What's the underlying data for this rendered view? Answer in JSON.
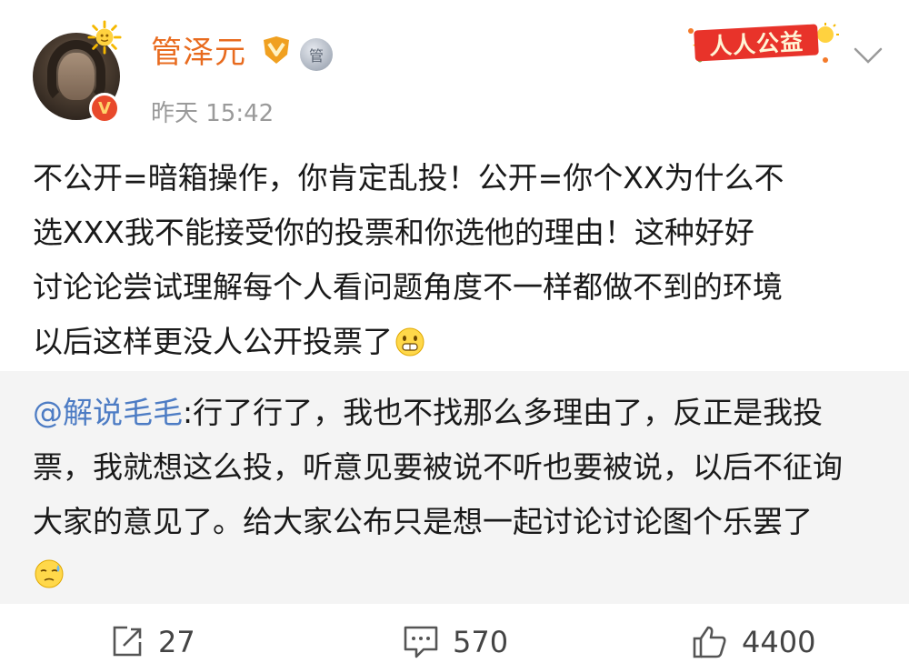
{
  "post": {
    "author": "管泽元",
    "time": "昨天 15:42",
    "badge_label": "人人公益",
    "medal_glyph": "管",
    "verified_glyph": "V",
    "body_lines": [
      "不公开=暗箱操作，你肯定乱投！公开=你个XX为什么不",
      "选XXX我不能接受你的投票和你选他的理由！这种好好",
      "讨论论尝试理解每个人看问题角度不一样都做不到的环境",
      "以后这样更没人公开投票了"
    ]
  },
  "quote": {
    "mention": "@解说毛毛",
    "lines": [
      ":行了行了，我也不找那么多理由了，反正是我投",
      "票，我就想这么投，听意见要被说不听也要被说，以后不征询",
      "大家的意见了。给大家公布只是想一起讨论讨论图个乐罢了"
    ]
  },
  "actions": {
    "repost_count": "27",
    "comment_count": "570",
    "like_count": "4400"
  },
  "colors": {
    "username": "#e86b1f",
    "mention": "#4d7cc4",
    "muted": "#9a9a9a",
    "quote_bg": "#f4f4f4",
    "badge_red": "#e8332a"
  },
  "icons": [
    "sun-icon",
    "verified-icon",
    "vip-icon",
    "medal-icon",
    "chevron-down-icon",
    "emoji-grin-icon",
    "emoji-sweat-icon",
    "repost-icon",
    "comment-icon",
    "like-icon"
  ]
}
